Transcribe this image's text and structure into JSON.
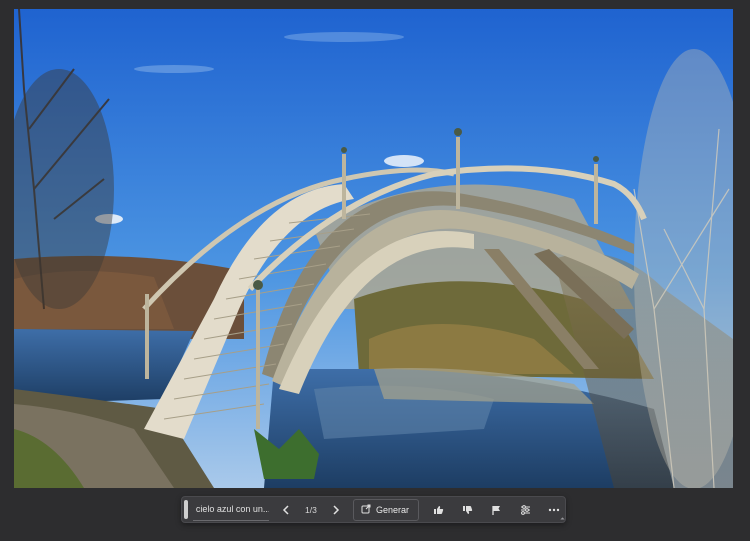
{
  "canvas": {
    "image_alt": "Puente de madera arqueado sobre un arroyo bajo cielo azul"
  },
  "taskbar": {
    "prompt_text": "cielo azul con un...",
    "prev_icon": "chevron-left-icon",
    "page_indicator": "1/3",
    "next_icon": "chevron-right-icon",
    "generate_label": "Generar",
    "generate_icon": "generate-icon",
    "like_icon": "thumbs-up-icon",
    "dislike_icon": "thumbs-down-icon",
    "report_icon": "flag-icon",
    "settings_icon": "sliders-icon",
    "more_icon": "more-icon"
  },
  "colors": {
    "background": "#2d2d2f",
    "taskbar": "#3b3b3e",
    "sky": "#2f78d6"
  }
}
